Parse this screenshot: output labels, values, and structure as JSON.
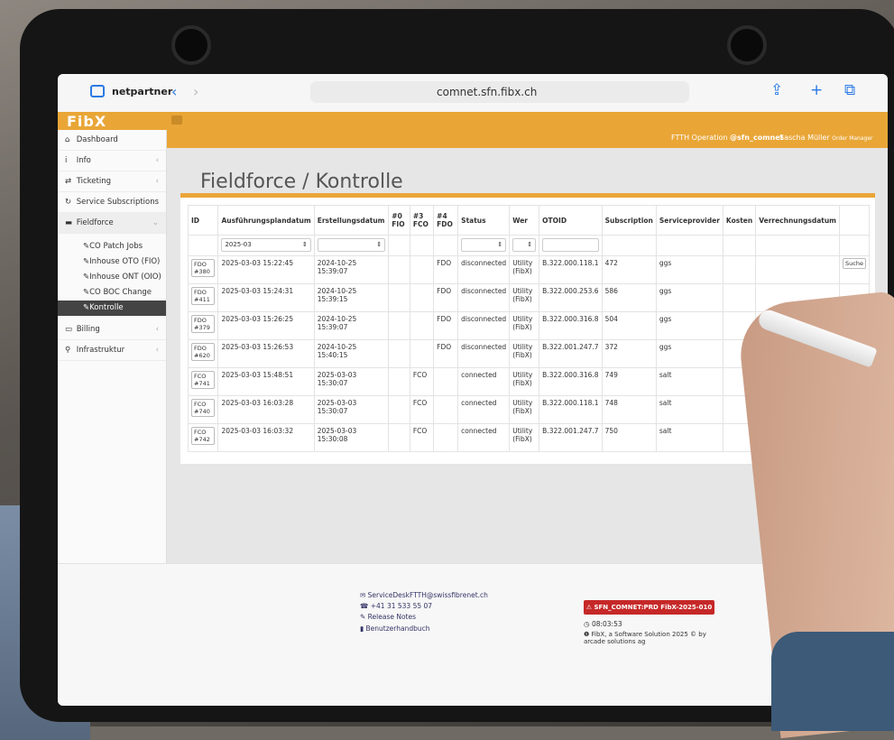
{
  "safari": {
    "tab_title": "netpartner",
    "url": "comnet.sfn.fibx.ch"
  },
  "app": {
    "logo": "FibX",
    "ftth_label": "FTTH Operation",
    "ftth_handle": "@sfn_comnet",
    "user_name": "Sascha Müller",
    "user_role": "Order Manager"
  },
  "sidebar": {
    "items": [
      {
        "icon": "dashboard-icon",
        "label": "Dashboard"
      },
      {
        "icon": "info-icon",
        "label": "Info"
      },
      {
        "icon": "ticketing-icon",
        "label": "Ticketing"
      },
      {
        "icon": "refresh-icon",
        "label": "Service Subscriptions"
      },
      {
        "icon": "truck-icon",
        "label": "Fieldforce"
      }
    ],
    "sub_items": [
      {
        "label": "CO Patch Jobs"
      },
      {
        "label": "Inhouse OTO (FIO)"
      },
      {
        "label": "Inhouse ONT (OIO)"
      },
      {
        "label": "CO BOC Change"
      },
      {
        "label": "Kontrolle"
      }
    ],
    "bottom_items": [
      {
        "icon": "billing-icon",
        "label": "Billing"
      },
      {
        "icon": "sitemap-icon",
        "label": "Infrastruktur"
      }
    ]
  },
  "page": {
    "title": "Fieldforce / Kontrolle"
  },
  "table": {
    "headers": [
      "ID",
      "Ausführungsplandatum",
      "Erstellungsdatum",
      "#0 FIO",
      "#3 FCO",
      "#4 FDO",
      "Status",
      "Wer",
      "OTOID",
      "Subscription",
      "Serviceprovider",
      "Kosten",
      "Verrechnungsdatum"
    ],
    "filter_date": "2025-03",
    "search_label": "Suche",
    "rows": [
      {
        "id": "FDO #380",
        "plan": "2025-03-03 15:22:45",
        "created": "2024-10-25 15:39:07",
        "fio": "",
        "fco": "",
        "fdo": "FDO",
        "status": "disconnected",
        "wer": "Utility (FibX)",
        "otoid": "B.322.000.118.1",
        "sub": "472",
        "sp": "ggs",
        "kosten": "",
        "verr": ""
      },
      {
        "id": "FDO #411",
        "plan": "2025-03-03 15:24:31",
        "created": "2024-10-25 15:39:15",
        "fio": "",
        "fco": "",
        "fdo": "FDO",
        "status": "disconnected",
        "wer": "Utility (FibX)",
        "otoid": "B.322.000.253.6",
        "sub": "586",
        "sp": "ggs",
        "kosten": "",
        "verr": ""
      },
      {
        "id": "FDO #379",
        "plan": "2025-03-03 15:26:25",
        "created": "2024-10-25 15:39:07",
        "fio": "",
        "fco": "",
        "fdo": "FDO",
        "status": "disconnected",
        "wer": "Utility (FibX)",
        "otoid": "B.322.000.316.8",
        "sub": "504",
        "sp": "ggs",
        "kosten": "",
        "verr": ""
      },
      {
        "id": "FDO #620",
        "plan": "2025-03-03 15:26:53",
        "created": "2024-10-25 15:40:15",
        "fio": "",
        "fco": "",
        "fdo": "FDO",
        "status": "disconnected",
        "wer": "Utility (FibX)",
        "otoid": "B.322.001.247.7",
        "sub": "372",
        "sp": "ggs",
        "kosten": "",
        "verr": ""
      },
      {
        "id": "FCO #741",
        "plan": "2025-03-03 15:48:51",
        "created": "2025-03-03 15:30:07",
        "fio": "",
        "fco": "FCO",
        "fdo": "",
        "status": "connected",
        "wer": "Utility (FibX)",
        "otoid": "B.322.000.316.8",
        "sub": "749",
        "sp": "salt",
        "kosten": "",
        "verr": ""
      },
      {
        "id": "FCO #740",
        "plan": "2025-03-03 16:03:28",
        "created": "2025-03-03 15:30:07",
        "fio": "",
        "fco": "FCO",
        "fdo": "",
        "status": "connected",
        "wer": "Utility (FibX)",
        "otoid": "B.322.000.118.1",
        "sub": "748",
        "sp": "salt",
        "kosten": "",
        "verr": ""
      },
      {
        "id": "FCO #742",
        "plan": "2025-03-03 16:03:32",
        "created": "2025-03-03 15:30:08",
        "fio": "",
        "fco": "FCO",
        "fdo": "",
        "status": "connected",
        "wer": "Utility (FibX)",
        "otoid": "B.322.001.247.7",
        "sub": "750",
        "sp": "salt",
        "kosten": "",
        "verr": ""
      }
    ]
  },
  "footer": {
    "email": "ServiceDeskFTTH@swissfibrenet.ch",
    "phone": "+41 31 533 55 07",
    "release_notes": "Release Notes",
    "manual": "Benutzerhandbuch",
    "prd_badge": "SFN_COMNET:PRD FibX-2025-010",
    "clock": "08:03:53",
    "copyright": "FibX, a Software Solution 2025 © by arcade solutions ag"
  },
  "colors": {
    "accent": "#e9a637",
    "prd_badge": "#c62828",
    "sidebar_active": "#444444"
  }
}
